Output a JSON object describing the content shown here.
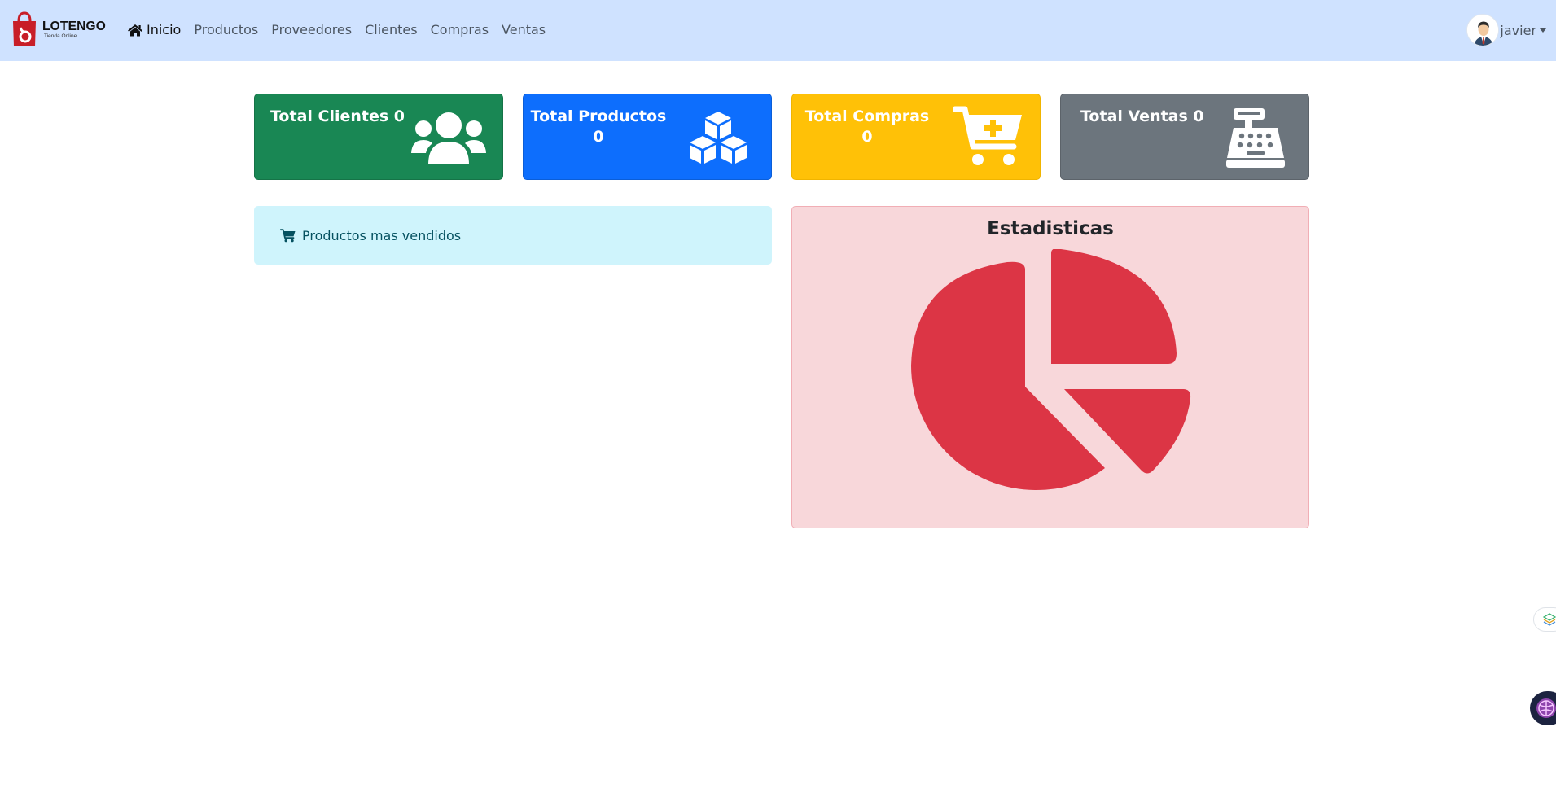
{
  "brand": {
    "name": "LOTENGO",
    "tagline": "Tienda Online"
  },
  "nav": {
    "items": [
      {
        "label": "Inicio",
        "active": true,
        "icon": "home-icon"
      },
      {
        "label": "Productos"
      },
      {
        "label": "Proveedores"
      },
      {
        "label": "Clientes"
      },
      {
        "label": "Compras"
      },
      {
        "label": "Ventas"
      }
    ]
  },
  "user": {
    "name": "javier"
  },
  "cards": [
    {
      "label": "Total Clientes 0",
      "icon": "users-icon",
      "color": "#198754"
    },
    {
      "label_line1": "Total Productos",
      "label_line2": "0",
      "icon": "cubes-icon",
      "color": "#0d6efd"
    },
    {
      "label_line1": "Total Compras",
      "label_line2": "0",
      "icon": "cart-plus-icon",
      "color": "#ffc107"
    },
    {
      "label": "Total Ventas 0",
      "icon": "cash-register-icon",
      "color": "#6c757d"
    }
  ],
  "top_products": {
    "label": "Productos mas vendidos",
    "icon": "cart-icon"
  },
  "statistics": {
    "title": "Estadisticas",
    "icon": "pie-chart-icon",
    "color": "#dc3545"
  }
}
